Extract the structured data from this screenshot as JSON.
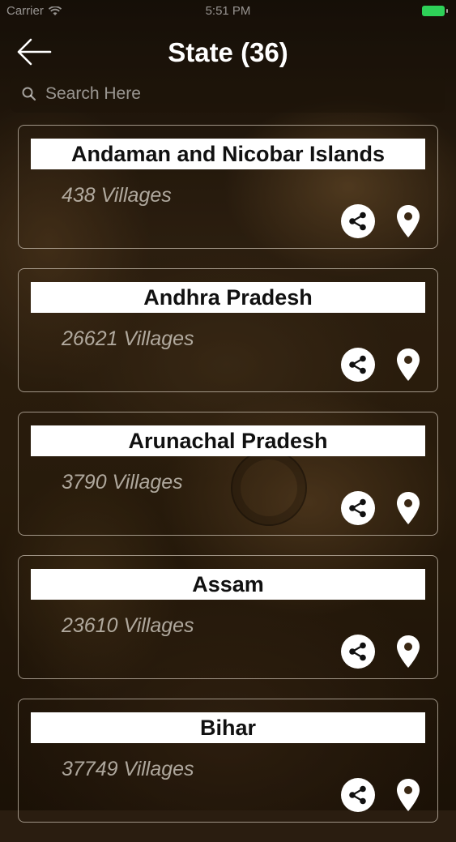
{
  "status_bar": {
    "carrier": "Carrier",
    "time": "5:51 PM",
    "battery_color": "#2ed158"
  },
  "header": {
    "title": "State (36)",
    "back_icon": "arrow-left-icon"
  },
  "search": {
    "placeholder": "Search Here",
    "value": "",
    "icon": "search-icon"
  },
  "states": [
    {
      "name": "Andaman and Nicobar Islands",
      "villages": "438 Villages"
    },
    {
      "name": "Andhra Pradesh",
      "villages": "26621 Villages"
    },
    {
      "name": "Arunachal Pradesh",
      "villages": "3790 Villages"
    },
    {
      "name": "Assam",
      "villages": "23610 Villages"
    },
    {
      "name": "Bihar",
      "villages": "37749 Villages"
    }
  ],
  "item_actions": {
    "share_icon": "share-icon",
    "location_icon": "map-pin-icon"
  }
}
